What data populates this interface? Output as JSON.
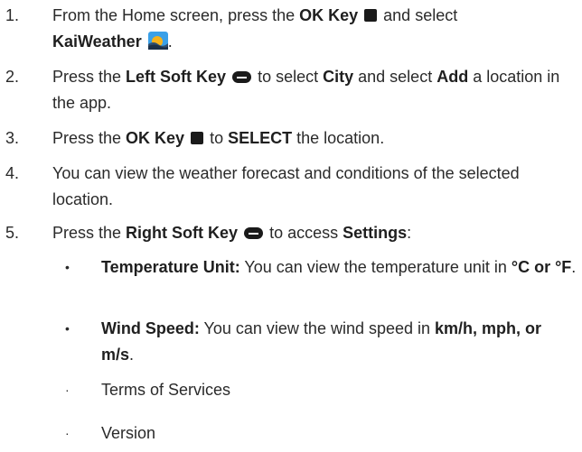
{
  "steps": [
    {
      "number": "1.",
      "t1": "From the Home screen, press the ",
      "b1": "OK Key",
      "t2": " and select ",
      "b2": "KaiWeather",
      "t3": ".",
      "icons": [
        "ok-key-icon",
        "kaiweather-app-icon"
      ]
    },
    {
      "number": "2.",
      "t1": "Press the ",
      "b1": "Left Soft Key",
      "t2": " to select ",
      "b2": "City",
      "t3": " and select ",
      "b3": "Add",
      "t4": " a location in the app.",
      "icons": [
        "soft-key-icon"
      ]
    },
    {
      "number": "3.",
      "t1": "Press the ",
      "b1": "OK Key",
      "t2": " to ",
      "b2": "SELECT",
      "t3": " the location.",
      "icons": [
        "ok-key-icon"
      ]
    },
    {
      "number": "4.",
      "t1": "You can view the weather forecast and conditions of the selected location."
    },
    {
      "number": "5.",
      "t1": "Press the ",
      "b1": "Right Soft Key",
      "t2": " to access ",
      "b2": "Settings",
      "t3": ":",
      "icons": [
        "soft-key-icon"
      ]
    }
  ],
  "settings_items": [
    {
      "bullet": "•",
      "label": "Temperature Unit:",
      "t1": " You can view the temperature unit in ",
      "b1": "°C or °F",
      "t2": "."
    },
    {
      "bullet": "•",
      "label": "Wind Speed:",
      "t1": " You can view the wind speed in ",
      "b1": "km/h, mph, or m/s",
      "t2": "."
    },
    {
      "bullet": "·",
      "t1": "Terms of Services"
    },
    {
      "bullet": "·",
      "t1": "Version"
    }
  ],
  "colors": {
    "text": "#2a2a2a",
    "icon": "#1a1a1a",
    "weather_icon_sky": "#3aa0e8",
    "weather_icon_sun": "#f6b21b"
  }
}
